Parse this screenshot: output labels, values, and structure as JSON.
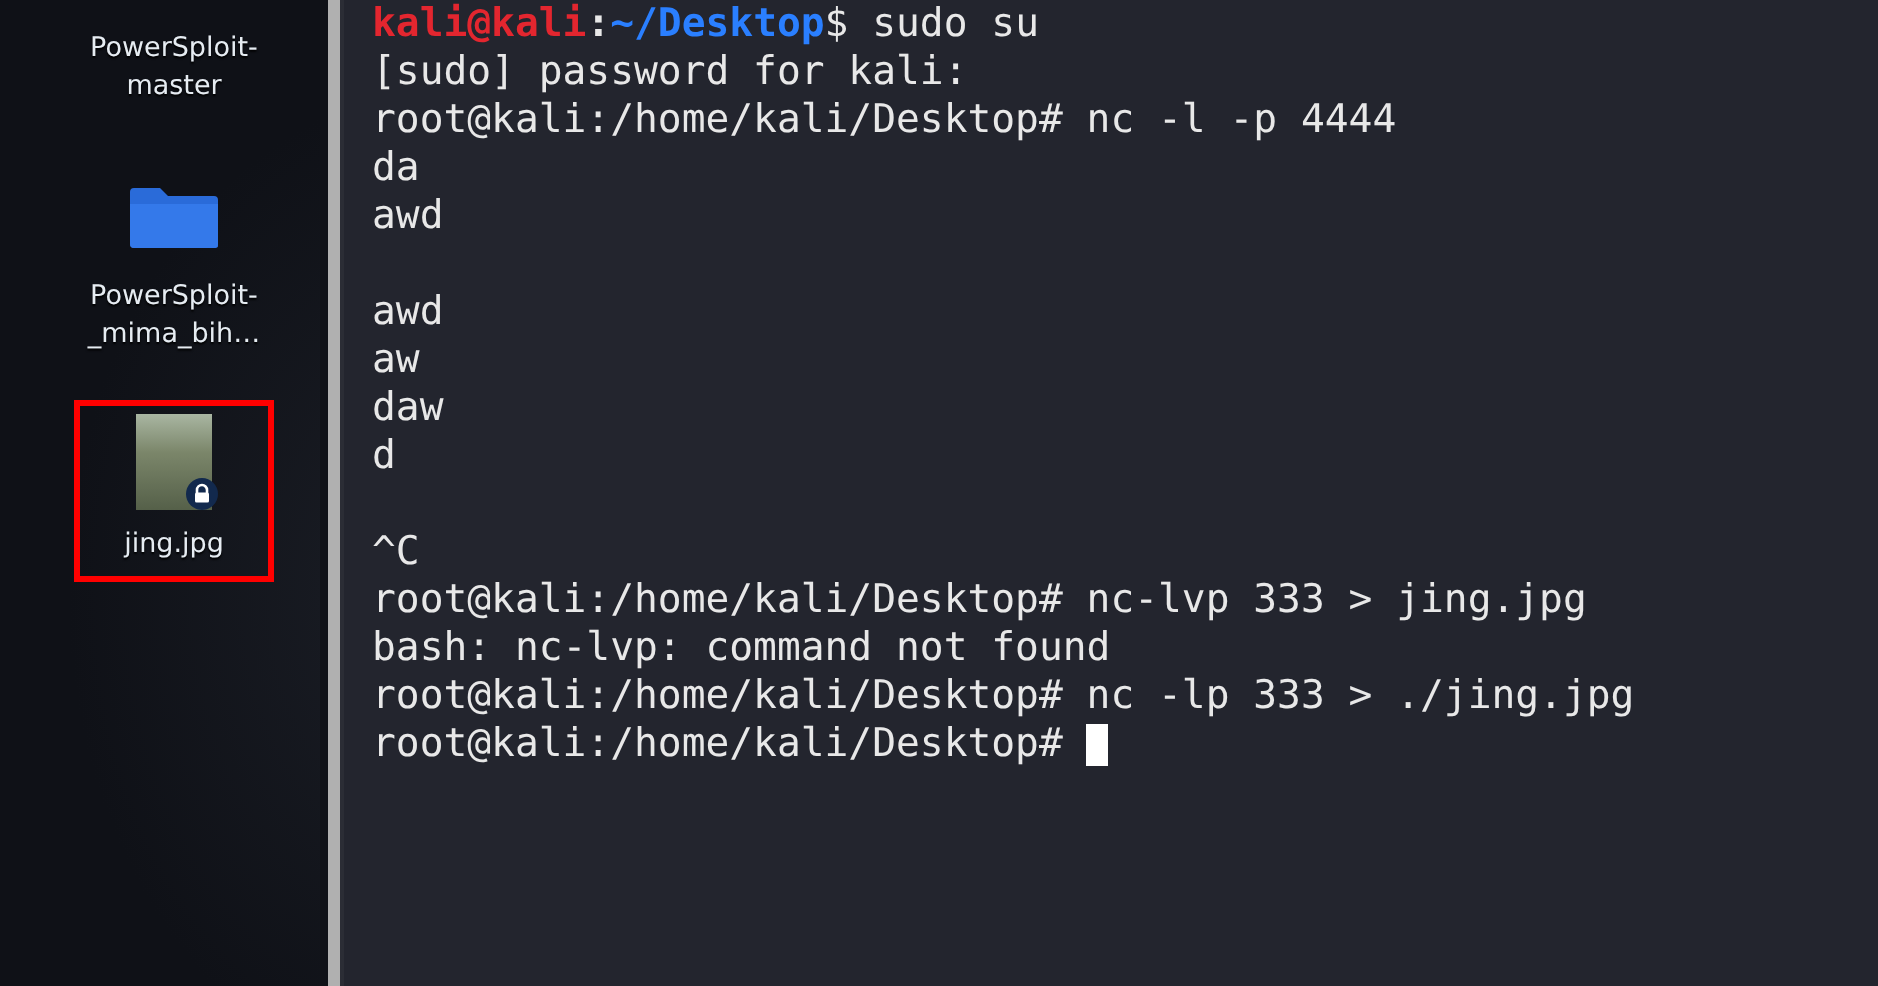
{
  "desktop": {
    "icons": [
      {
        "kind": "text_only",
        "label": "PowerSploit-master",
        "highlighted": false
      },
      {
        "kind": "folder",
        "label": "PowerSploit-_mima_bih…",
        "highlighted": false
      },
      {
        "kind": "image",
        "label": "jing.jpg",
        "highlighted": true,
        "locked": true
      }
    ]
  },
  "terminal": {
    "lines": [
      {
        "kind": "user_prompt",
        "user": "kali@kali",
        "separator": ":",
        "path": "~/Desktop",
        "rest": "$ sudo su"
      },
      {
        "kind": "text",
        "text": "[sudo] password for kali:"
      },
      {
        "kind": "text",
        "text": "root@kali:/home/kali/Desktop# nc -l -p 4444"
      },
      {
        "kind": "text",
        "text": "da"
      },
      {
        "kind": "text",
        "text": "awd"
      },
      {
        "kind": "blank"
      },
      {
        "kind": "text",
        "text": "awd"
      },
      {
        "kind": "text",
        "text": "aw"
      },
      {
        "kind": "text",
        "text": "daw"
      },
      {
        "kind": "text",
        "text": "d"
      },
      {
        "kind": "blank"
      },
      {
        "kind": "text",
        "text": "^C"
      },
      {
        "kind": "text",
        "text": "root@kali:/home/kali/Desktop# nc-lvp 333 > jing.jpg"
      },
      {
        "kind": "text",
        "text": "bash: nc-lvp: command not found"
      },
      {
        "kind": "text",
        "text": "root@kali:/home/kali/Desktop# nc -lp 333 > ./jing.jpg"
      },
      {
        "kind": "text",
        "text": "root@kali:/home/kali/Desktop# ",
        "cursor": true
      }
    ]
  }
}
